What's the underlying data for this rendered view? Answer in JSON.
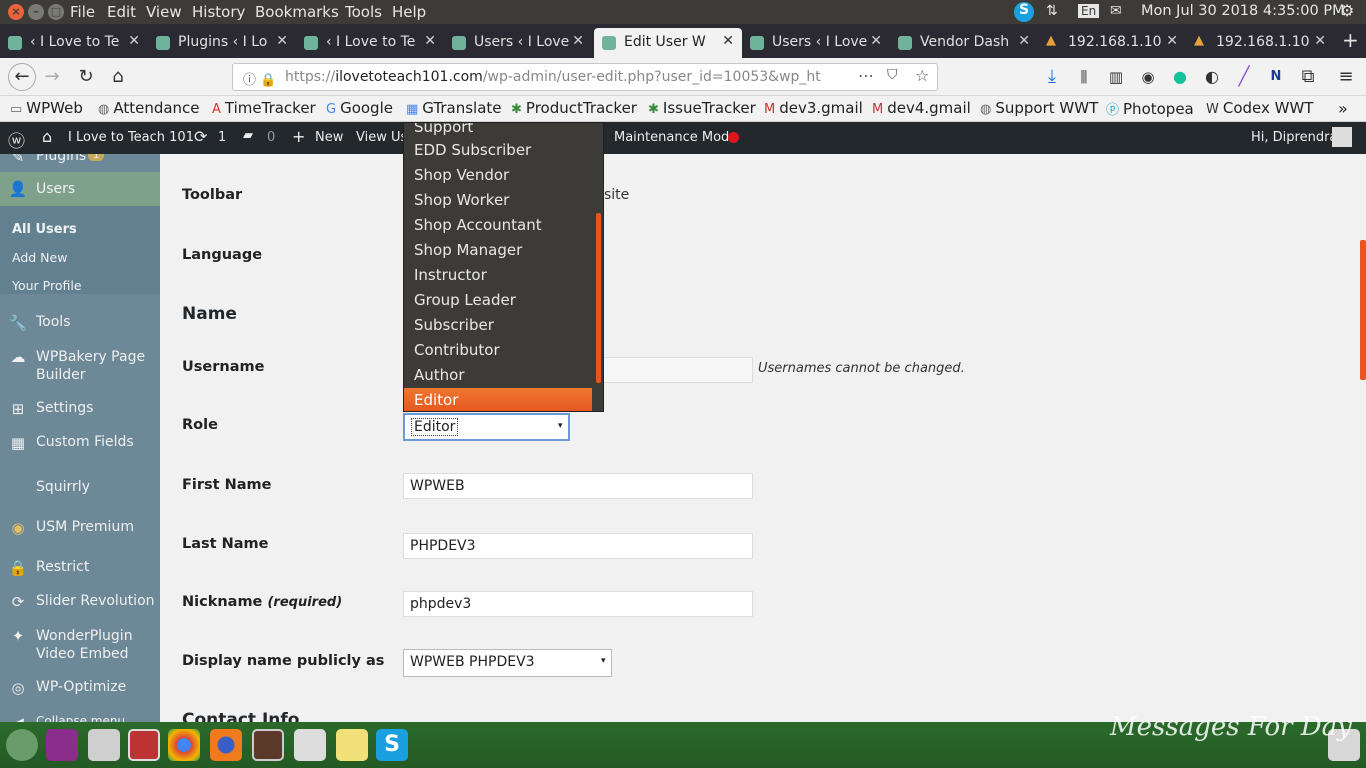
{
  "system": {
    "menu": [
      "File",
      "Edit",
      "View",
      "History",
      "Bookmarks",
      "Tools",
      "Help"
    ],
    "lang": "En",
    "clock": "Mon Jul 30 2018  4:35:00 PM"
  },
  "tabs": [
    {
      "title": "‹ I Love to Te",
      "active": false
    },
    {
      "title": "Plugins ‹ I Lo",
      "active": false
    },
    {
      "title": "‹ I Love to Te",
      "active": false
    },
    {
      "title": "Users ‹ I Love",
      "active": false
    },
    {
      "title": "Edit User W",
      "active": true
    },
    {
      "title": "Users ‹ I Love",
      "active": false
    },
    {
      "title": "Vendor Dash",
      "active": false
    },
    {
      "title": "192.168.1.10",
      "active": false
    },
    {
      "title": "192.168.1.10",
      "active": false
    }
  ],
  "url": {
    "prefix": "https://",
    "domain": "ilovetoteach101.com",
    "path": "/wp-admin/user-edit.php?user_id=10053&wp_ht"
  },
  "bookmarks": [
    "WPWeb",
    "Attendance",
    "TimeTracker",
    "Google",
    "GTranslate",
    "ProductTracker",
    "IssueTracker",
    "dev3.gmail",
    "dev4.gmail",
    "Support WWT",
    "Photopea",
    "Codex WWT"
  ],
  "adminbar": {
    "site": "I Love to Teach 101",
    "updates": "1",
    "comments": "0",
    "new": "New",
    "view": "View Us",
    "maintenance": "Maintenance Mode",
    "greeting": "Hi, Diprendra"
  },
  "sidebar": {
    "plugins": "Plugins",
    "plugins_badge": "1",
    "users": "Users",
    "sub": [
      "All Users",
      "Add New",
      "Your Profile"
    ],
    "items": [
      "Tools",
      "WPBakery Page Builder",
      "Settings",
      "Custom Fields",
      "Squirrly",
      "USM Premium",
      "Restrict",
      "Slider Revolution",
      "WonderPlugin Video Embed",
      "WP-Optimize",
      "Collapse menu"
    ]
  },
  "form": {
    "toolbar_label": "Toolbar",
    "toolbar_desc_tail": "site",
    "language_label": "Language",
    "name_heading": "Name",
    "username_label": "Username",
    "username_note": "Usernames cannot be changed.",
    "role_label": "Role",
    "role_value": "Editor",
    "first_name_label": "First Name",
    "first_name": "WPWEB",
    "last_name_label": "Last Name",
    "last_name": "PHPDEV3",
    "nickname_label": "Nickname",
    "nickname_required": "(required)",
    "nickname": "phpdev3",
    "display_label": "Display name publicly as",
    "display_value": "WPWEB PHPDEV3",
    "contact_heading": "Contact Info"
  },
  "role_options": [
    "Support",
    "EDD Subscriber",
    "Shop Vendor",
    "Shop Worker",
    "Shop Accountant",
    "Shop Manager",
    "Instructor",
    "Group Leader",
    "Subscriber",
    "Contributor",
    "Author",
    "Editor"
  ],
  "wallpaper_text": "Messages For Day",
  "colors": {
    "accent": "#e95420",
    "sidebar": "#6d8897",
    "adminbar": "#23282d"
  }
}
